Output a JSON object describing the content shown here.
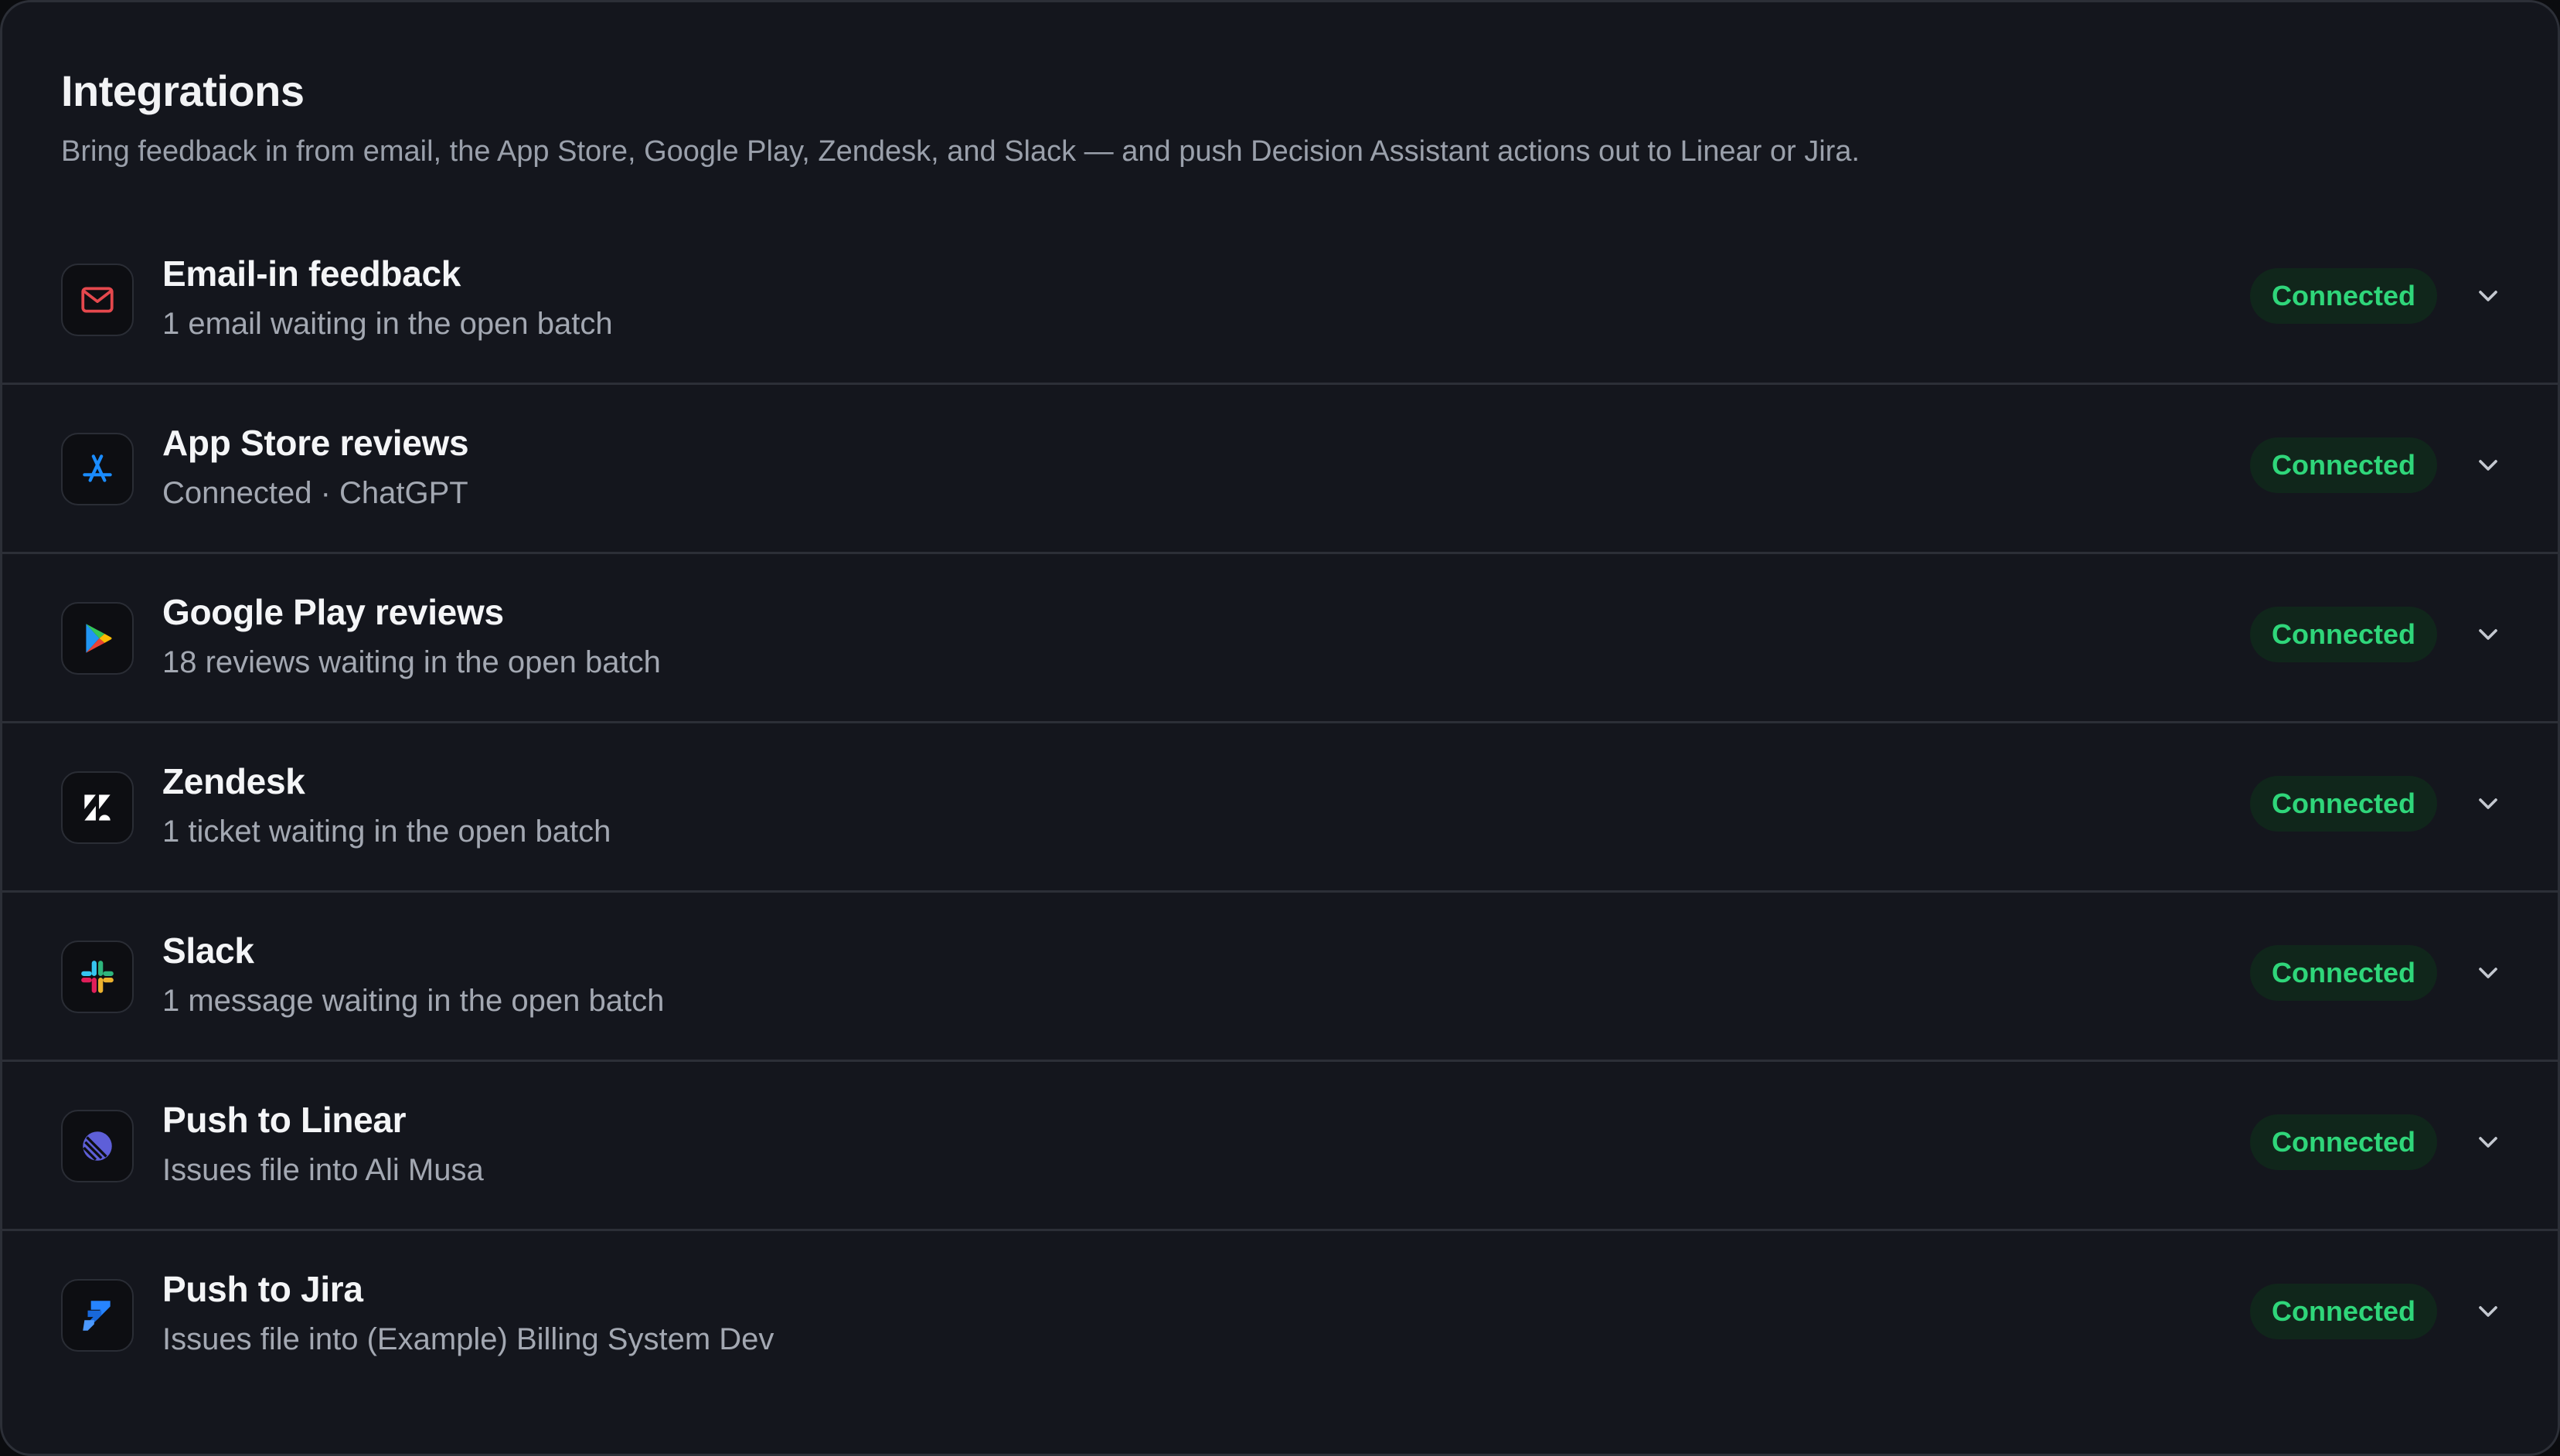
{
  "header": {
    "title": "Integrations",
    "subtitle": "Bring feedback in from email, the App Store, Google Play, Zendesk, and Slack — and push Decision Assistant actions out to Linear or Jira."
  },
  "colors": {
    "panel_bg": "#14161d",
    "badge_bg": "#10261b",
    "badge_text": "#2fd67a",
    "email_icon": "#e5484d",
    "appstore_icon": "#1a8cff",
    "linear_icon": "#6366f1",
    "jira_icon": "#2684ff"
  },
  "integrations": [
    {
      "icon": "mail-icon",
      "title": "Email-in feedback",
      "subtitle": "1 email waiting in the open batch",
      "status": "Connected"
    },
    {
      "icon": "app-store-icon",
      "title": "App Store reviews",
      "subtitle": "Connected · ChatGPT",
      "status": "Connected"
    },
    {
      "icon": "google-play-icon",
      "title": "Google Play reviews",
      "subtitle": "18 reviews waiting in the open batch",
      "status": "Connected"
    },
    {
      "icon": "zendesk-icon",
      "title": "Zendesk",
      "subtitle": "1 ticket waiting in the open batch",
      "status": "Connected"
    },
    {
      "icon": "slack-icon",
      "title": "Slack",
      "subtitle": "1 message waiting in the open batch",
      "status": "Connected"
    },
    {
      "icon": "linear-icon",
      "title": "Push to Linear",
      "subtitle": "Issues file into Ali Musa",
      "status": "Connected"
    },
    {
      "icon": "jira-icon",
      "title": "Push to Jira",
      "subtitle": "Issues file into (Example) Billing System Dev",
      "status": "Connected"
    }
  ]
}
